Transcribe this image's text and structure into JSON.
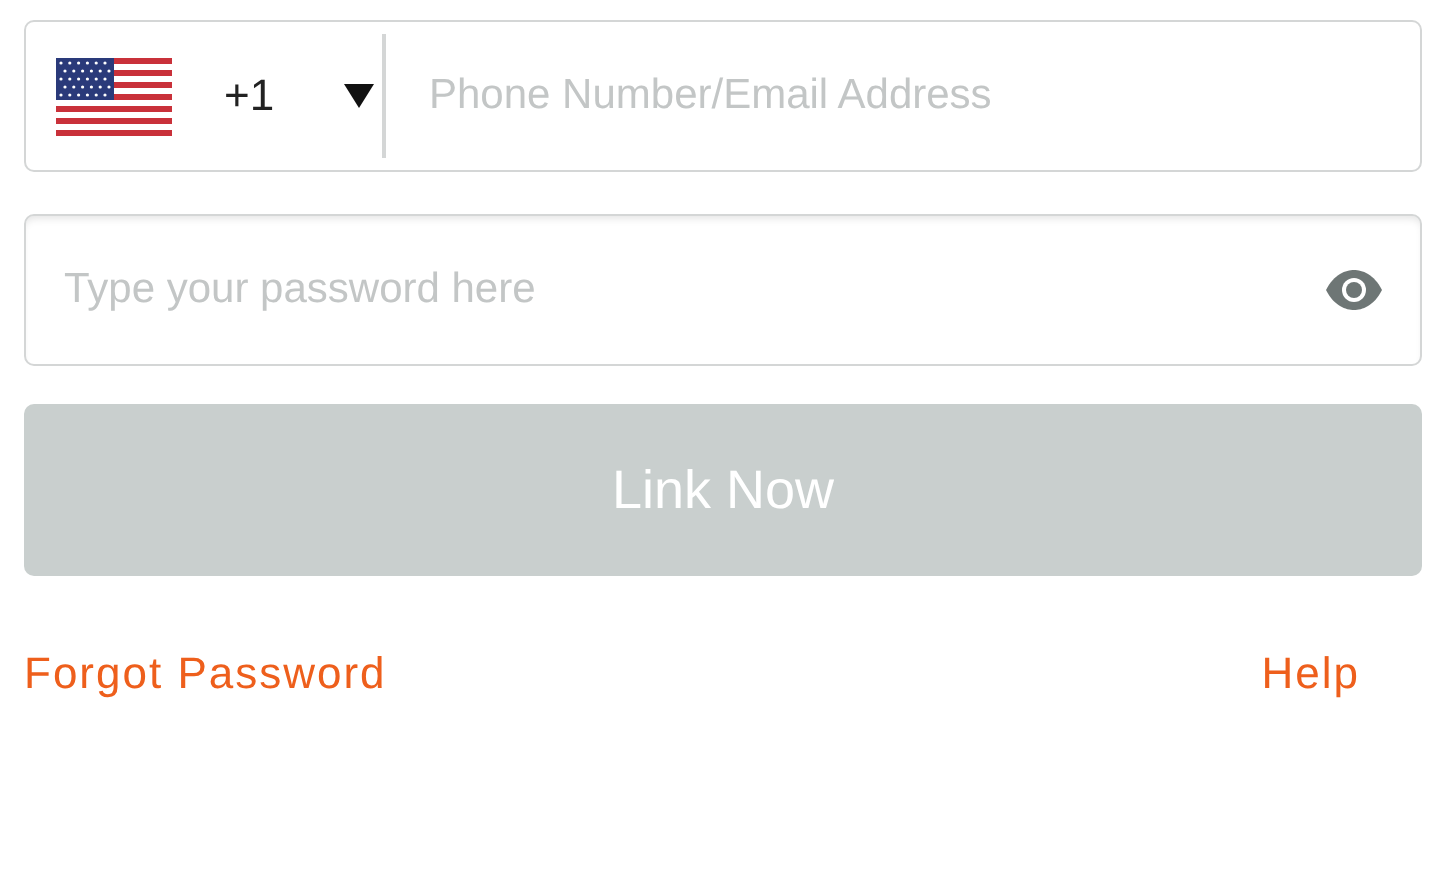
{
  "phone_field": {
    "country_code": "+1",
    "placeholder": "Phone Number/Email Address"
  },
  "password_field": {
    "placeholder": "Type your password here"
  },
  "submit_button": {
    "label": "Link Now",
    "disabled": true
  },
  "links": [
    {
      "label": "Forgot Password"
    },
    {
      "label": "Help"
    }
  ]
}
